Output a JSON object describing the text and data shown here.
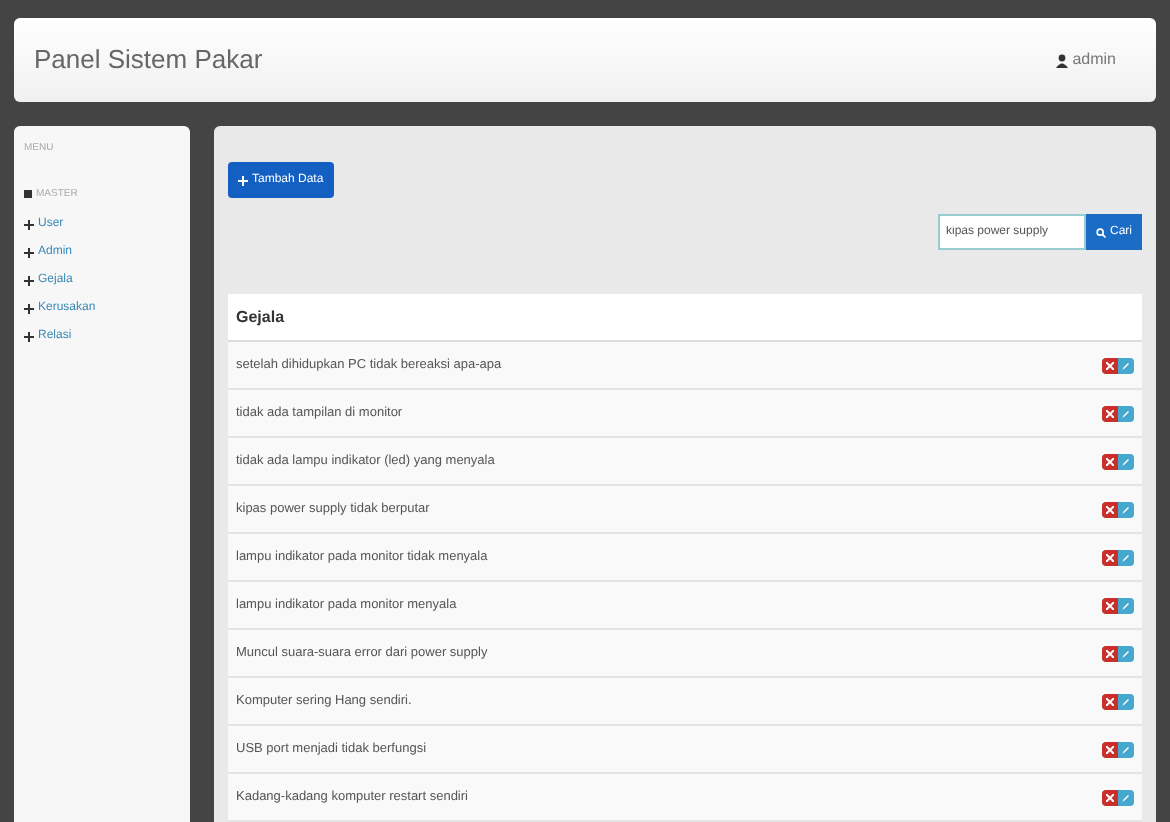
{
  "navbar": {
    "brand": "Panel Sistem Pakar",
    "user": "admin"
  },
  "sidebar": {
    "title": "MENU",
    "section": "MASTER",
    "items": [
      {
        "label": "User"
      },
      {
        "label": "Admin"
      },
      {
        "label": "Gejala"
      },
      {
        "label": "Kerusakan"
      },
      {
        "label": "Relasi"
      }
    ]
  },
  "add_button": "Tambah Data",
  "search": {
    "value": "kipas power supply",
    "button": "Cari"
  },
  "table": {
    "columns": [
      "Gejala"
    ],
    "rows": [
      {
        "gejala": "setelah dihidupkan PC tidak bereaksi apa-apa"
      },
      {
        "gejala": "tidak ada tampilan di monitor"
      },
      {
        "gejala": "tidak ada lampu indikator (led) yang menyala"
      },
      {
        "gejala": "kipas power supply tidak berputar"
      },
      {
        "gejala": "lampu indikator pada monitor tidak menyala"
      },
      {
        "gejala": "lampu indikator pada monitor menyala"
      },
      {
        "gejala": "Muncul suara-suara error dari power supply"
      },
      {
        "gejala": "Komputer sering Hang sendiri."
      },
      {
        "gejala": "USB port menjadi tidak berfungsi"
      },
      {
        "gejala": "Kadang-kadang komputer restart sendiri"
      }
    ]
  }
}
